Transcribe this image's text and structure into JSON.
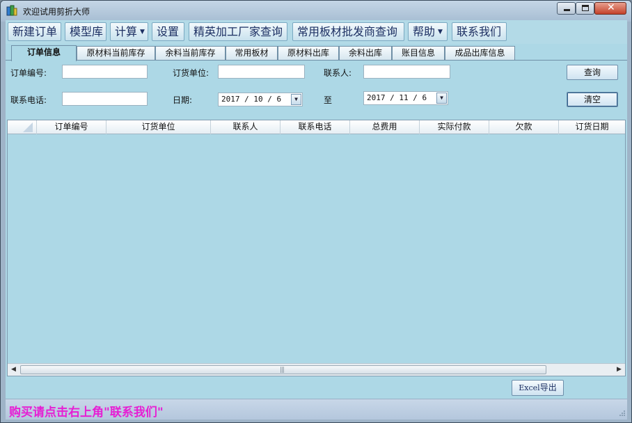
{
  "window": {
    "title": "欢迎试用剪折大师",
    "controls": {
      "minimize": "minimize-icon",
      "maximize": "maximize-icon",
      "close": "close-icon"
    }
  },
  "menu": {
    "items": [
      {
        "label": "新建订单",
        "dropdown": false
      },
      {
        "label": "模型库",
        "dropdown": false
      },
      {
        "label": "计算",
        "dropdown": true
      },
      {
        "label": "设置",
        "dropdown": false
      },
      {
        "label": "精英加工厂家查询",
        "dropdown": false
      },
      {
        "label": "常用板材批发商查询",
        "dropdown": false
      },
      {
        "label": "帮助",
        "dropdown": true
      },
      {
        "label": "联系我们",
        "dropdown": false
      }
    ]
  },
  "tabs": {
    "active": 0,
    "items": [
      "订单信息",
      "原材料当前库存",
      "余料当前库存",
      "常用板材",
      "原材料出库",
      "余料出库",
      "账目信息",
      "成品出库信息"
    ]
  },
  "filters": {
    "order_no_label": "订单编号:",
    "order_no_value": "",
    "customer_label": "订货单位:",
    "customer_value": "",
    "contact_label": "联系人:",
    "contact_value": "",
    "phone_label": "联系电话:",
    "phone_value": "",
    "date_label": "日期:",
    "date_from": "2017 / 10 / 6",
    "to_label": "至",
    "date_to": "2017 / 11 / 6",
    "query_button": "查询",
    "clear_button": "清空"
  },
  "grid": {
    "columns": [
      "订单编号",
      "订货单位",
      "联系人",
      "联系电话",
      "总费用",
      "实际付款",
      "欠款",
      "订货日期"
    ],
    "rows": []
  },
  "export": {
    "prefix": "Excel",
    "suffix": "导出"
  },
  "status": {
    "text": "购买请点击右上角\"联系我们\"",
    "color": "#e61fd4"
  },
  "colors": {
    "client_bg": "#add8e6",
    "menu_text": "#1c2f62"
  }
}
